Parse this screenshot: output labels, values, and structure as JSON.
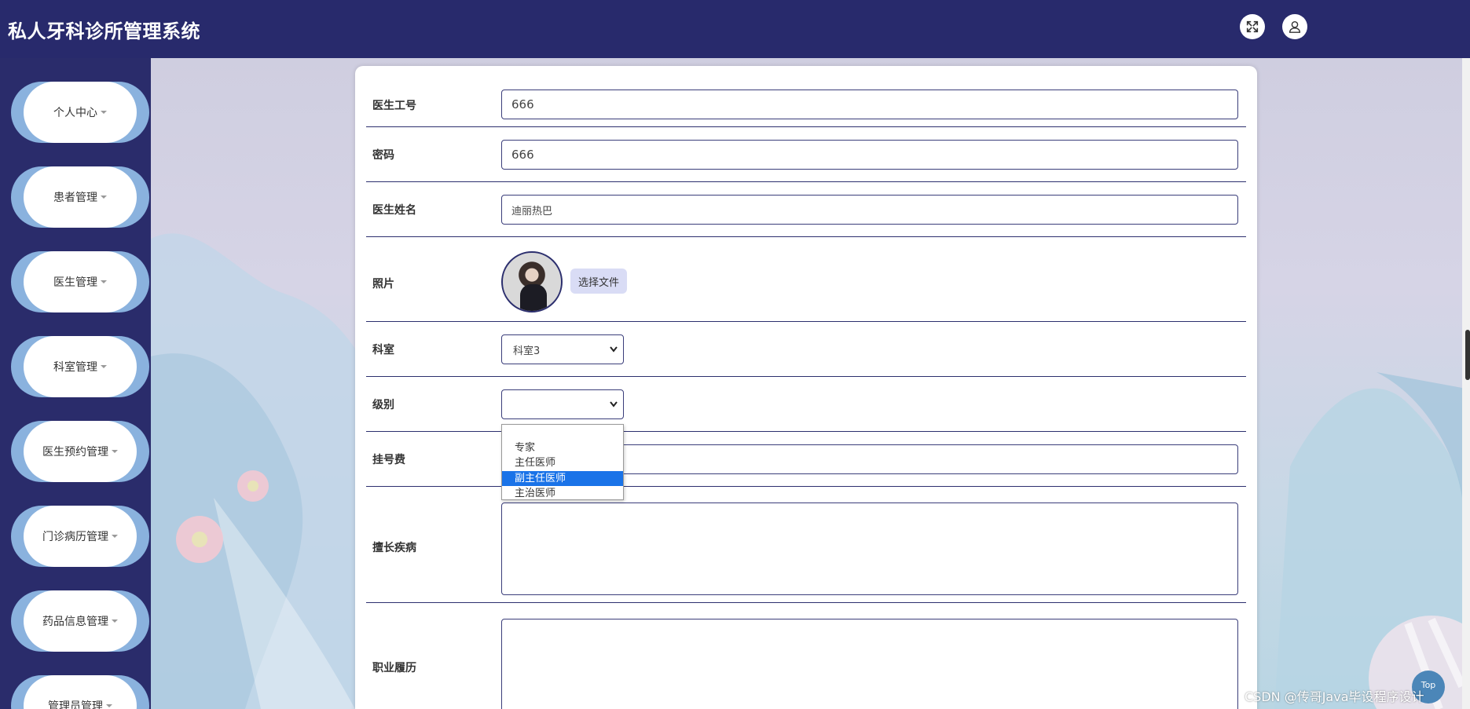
{
  "header": {
    "title": "私人牙科诊所管理系统",
    "icons": [
      "fullscreen-icon",
      "user-icon"
    ]
  },
  "sidebar": {
    "items": [
      {
        "label": "个人中心"
      },
      {
        "label": "患者管理"
      },
      {
        "label": "医生管理"
      },
      {
        "label": "科室管理"
      },
      {
        "label": "医生预约管理"
      },
      {
        "label": "门诊病历管理"
      },
      {
        "label": "药品信息管理"
      },
      {
        "label": "管理员管理"
      }
    ]
  },
  "form": {
    "doctor_id": {
      "label": "医生工号",
      "value": "666"
    },
    "password": {
      "label": "密码",
      "value": "666"
    },
    "doctor_name": {
      "label": "医生姓名",
      "value": "迪丽热巴"
    },
    "photo": {
      "label": "照片",
      "button": "选择文件"
    },
    "department": {
      "label": "科室",
      "value": "科室3"
    },
    "level": {
      "label": "级别",
      "value": "",
      "options": [
        "",
        "专家",
        "主任医师",
        "副主任医师",
        "主治医师"
      ],
      "highlighted": "副主任医师"
    },
    "fee": {
      "label": "挂号费",
      "value": ""
    },
    "specialty": {
      "label": "擅长疾病",
      "value": ""
    },
    "career": {
      "label": "职业履历",
      "value": ""
    }
  },
  "footer": {
    "watermark": "CSDN @传哥Java毕设程序设计",
    "top_button": "Top"
  },
  "colors": {
    "header_bg": "#282a6c",
    "sidebar_bg": "#2a2c6b",
    "menu_accent": "#8ab2de",
    "border": "#2c2f6e",
    "file_button": "#d9dcf5",
    "option_highlight": "#1a73e8"
  }
}
